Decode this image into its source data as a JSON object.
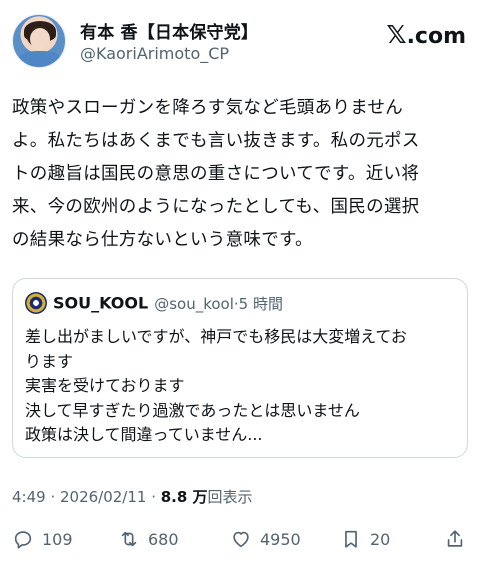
{
  "author": {
    "name": "有本 香【日本保守党】",
    "handle": "@KaoriArimoto_CP"
  },
  "watermark": {
    "symbol": "𝕏",
    "text": ".com"
  },
  "post": {
    "text": "政策やスローガンを降ろす気など毛頭ありません\nよ。私たちはあくまでも言い抜きます。私の元ポス\nトの趣旨は国民の意思の重さについてです。近い将\n来、今の欧州のようになったとしても、国民の選択\nの結果なら仕方ないという意味です。"
  },
  "quote": {
    "name": "SOU_KOOL",
    "handle_time": "@sou_kool·5 時間",
    "text": "差し出がましいですが、神戸でも移民は大変増えてお\nります\n実害を受けております\n決して早すぎたり過激であったとは思いません\n政策は決して間違っていません..."
  },
  "meta": {
    "time_date": "4:49 · 2026/02/11 · ",
    "views_count": "8.8 万",
    "views_label": "回表示"
  },
  "actions": {
    "replies": "109",
    "reposts": "680",
    "likes": "4950",
    "bookmarks": "20"
  },
  "icons": [
    "reply-icon",
    "repost-icon",
    "like-icon",
    "bookmark-icon",
    "share-icon"
  ]
}
